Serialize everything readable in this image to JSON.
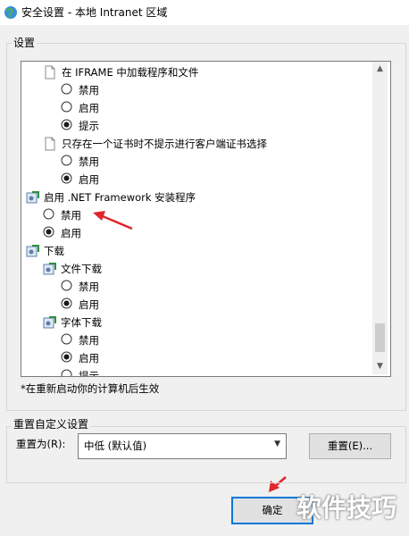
{
  "window": {
    "title": "安全设置 - 本地 Intranet 区域"
  },
  "settings_group": {
    "legend": "设置"
  },
  "tree": {
    "items": [
      {
        "label": "在 IFRAME 中加载程序和文件"
      },
      {
        "label": "禁用",
        "checked": false
      },
      {
        "label": "启用",
        "checked": false
      },
      {
        "label": "提示",
        "checked": true
      },
      {
        "label": "只存在一个证书时不提示进行客户端证书选择"
      },
      {
        "label": "禁用",
        "checked": false
      },
      {
        "label": "启用",
        "checked": true
      },
      {
        "label": "启用 .NET Framework 安装程序"
      },
      {
        "label": "禁用",
        "checked": false
      },
      {
        "label": "启用",
        "checked": true
      },
      {
        "label": "下载"
      },
      {
        "label": "文件下载"
      },
      {
        "label": "禁用",
        "checked": false
      },
      {
        "label": "启用",
        "checked": true
      },
      {
        "label": "字体下载"
      },
      {
        "label": "禁用",
        "checked": false
      },
      {
        "label": "启用",
        "checked": true
      },
      {
        "label": "提示",
        "checked": false
      }
    ]
  },
  "note": "*在重新启动你的计算机后生效",
  "reset_group": {
    "legend": "重置自定义设置",
    "reset_to_label": "重置为(R):",
    "select_value": "中低 (默认值)",
    "reset_button": "重置(E)..."
  },
  "footer": {
    "ok_button": "确定"
  },
  "watermark": {
    "text": "软件技巧"
  },
  "colors": {
    "arrow": "#e0262b",
    "ok_border": "#0078d7",
    "radio_dot": "#1a1a1a"
  }
}
